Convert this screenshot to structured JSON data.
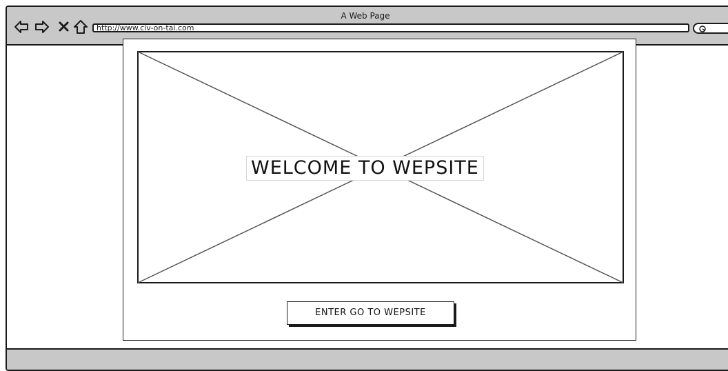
{
  "browser": {
    "page_title": "A Web Page",
    "url": "http://www.civ-on-tai.com",
    "nav_icons": [
      "back-arrow-icon",
      "forward-arrow-icon",
      "close-x-icon",
      "home-icon"
    ],
    "search_icon": "search-icon"
  },
  "main": {
    "hero_image": "image-placeholder",
    "welcome_text": "WELCOME TO WEPSITE",
    "enter_button_label": "ENTER GO TO WEPSITE"
  }
}
